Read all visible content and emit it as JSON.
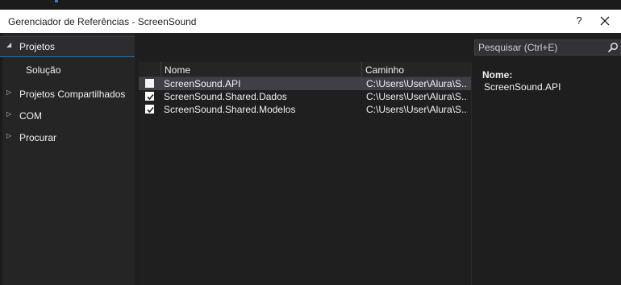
{
  "window": {
    "title": "Gerenciador de Referências - ScreenSound",
    "help_label": "?",
    "close_label": "✕"
  },
  "sidebar": {
    "items": [
      {
        "label": "Projetos",
        "arrow": "◢",
        "selected": true
      },
      {
        "label": "Solução",
        "arrow": "",
        "sub": true
      },
      {
        "label": "Projetos Compartilhados",
        "arrow": "▷"
      },
      {
        "label": "COM",
        "arrow": "▷"
      },
      {
        "label": "Procurar",
        "arrow": "▷"
      }
    ]
  },
  "table": {
    "columns": [
      "Nome",
      "Caminho"
    ],
    "rows": [
      {
        "name": "ScreenSound.API",
        "path": "C:\\Users\\User\\Alura\\S...",
        "checked": false,
        "selected": true
      },
      {
        "name": "ScreenSound.Shared.Dados",
        "path": "C:\\Users\\User\\Alura\\S...",
        "checked": true
      },
      {
        "name": "ScreenSound.Shared.Modelos",
        "path": "C:\\Users\\User\\Alura\\S...",
        "checked": true
      }
    ]
  },
  "search": {
    "placeholder": "Pesquisar (Ctrl+E)",
    "icon": "search-icon"
  },
  "details": {
    "name_label": "Nome:",
    "name_value": "ScreenSound.API"
  },
  "colors": {
    "background": "#1e1e1e",
    "sidebar": "#252526",
    "selected_row": "#3f3f46",
    "accent": "#007acc"
  }
}
